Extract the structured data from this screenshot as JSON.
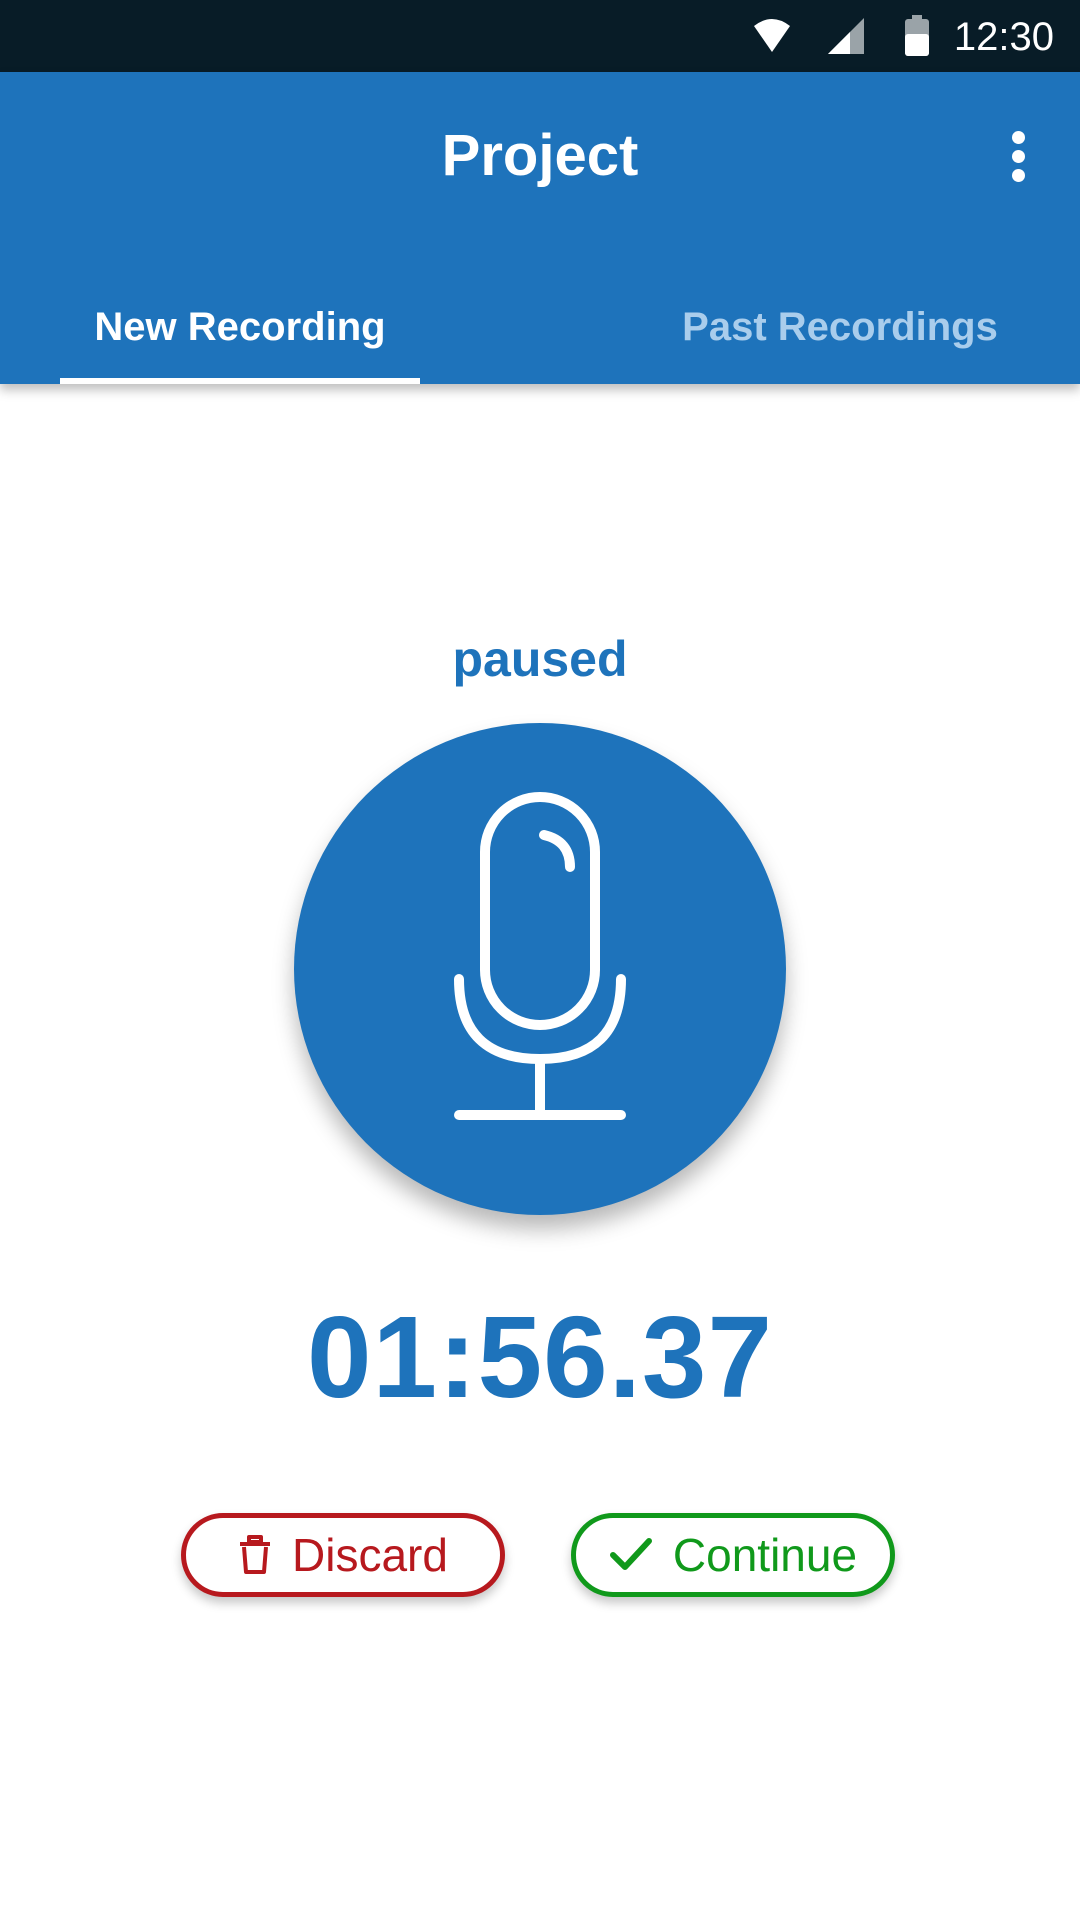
{
  "status_bar": {
    "time": "12:30",
    "icons": [
      "wifi-icon",
      "cellular-signal-icon",
      "battery-icon"
    ]
  },
  "app_bar": {
    "title": "Project",
    "menu_icon": "more-vert-icon"
  },
  "tabs": [
    {
      "label": "New Recording",
      "selected": true
    },
    {
      "label": "Past Recordings",
      "selected": false
    }
  ],
  "recorder": {
    "state": "paused",
    "mic_icon": "microphone-icon",
    "elapsed": "01:56.37"
  },
  "actions": {
    "discard": {
      "label": "Discard",
      "icon": "trash-icon",
      "color": "#b7191e"
    },
    "continue": {
      "label": "Continue",
      "icon": "check-icon",
      "color": "#10991b"
    }
  },
  "colors": {
    "primary": "#1e73bb",
    "status_bar": "#081c27",
    "tab_inactive": "#a9cdec"
  }
}
